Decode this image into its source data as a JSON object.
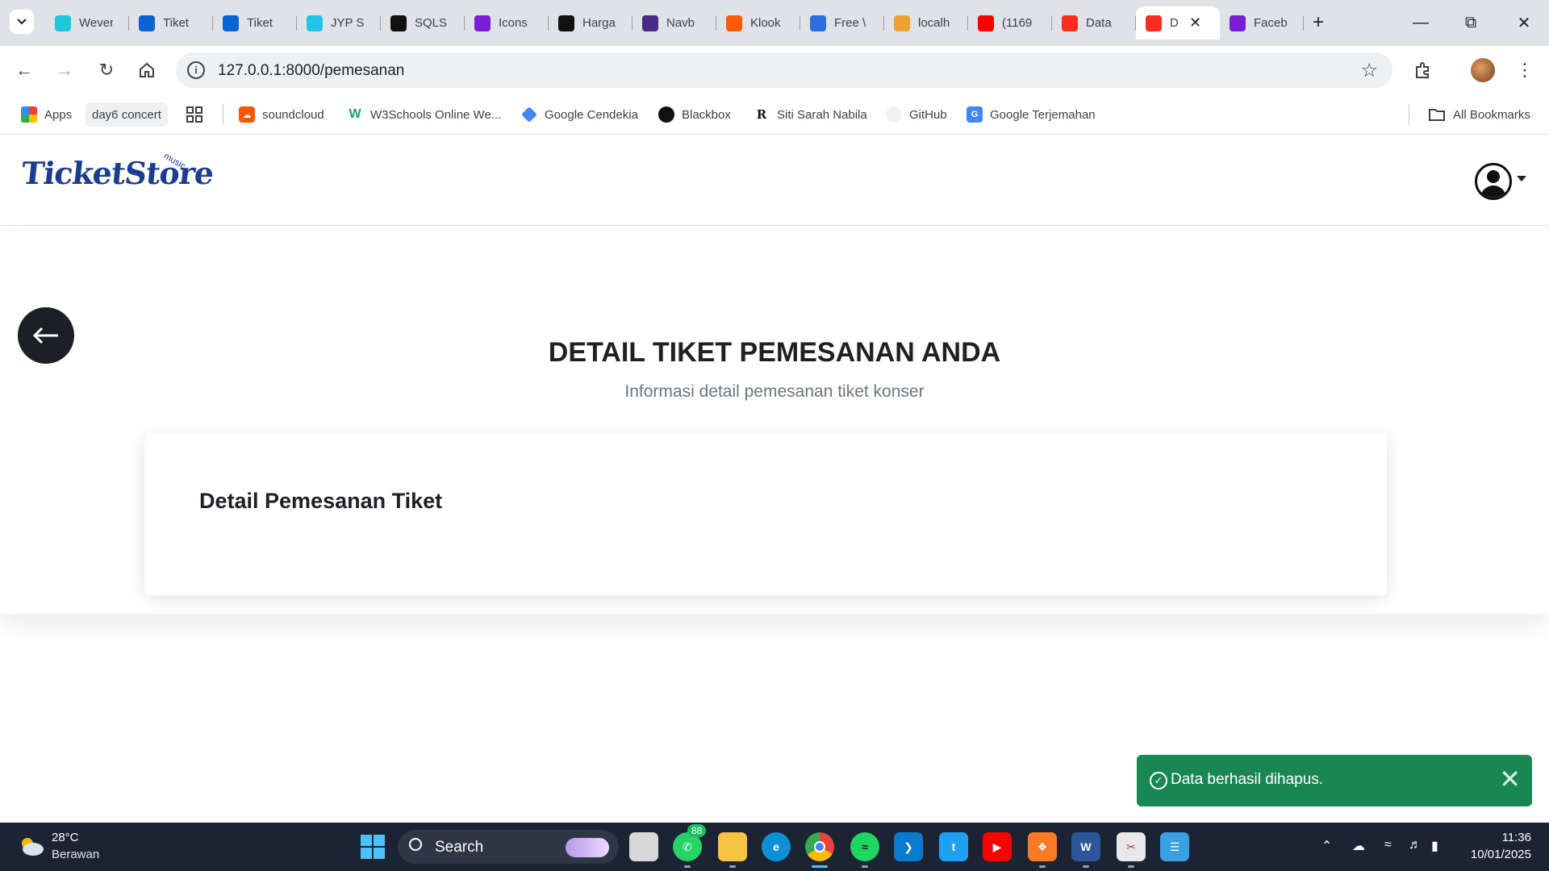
{
  "browser": {
    "tabs": [
      {
        "label": "Wever",
        "icon": "weverse-icon",
        "color": "#1ec8d8"
      },
      {
        "label": "Tiket",
        "icon": "tiket-icon",
        "color": "#0a64d6"
      },
      {
        "label": "Tiket",
        "icon": "tiket-icon",
        "color": "#0a64d6"
      },
      {
        "label": "JYP SI",
        "icon": "jyp-icon",
        "color": "#20c4e8"
      },
      {
        "label": "SQLS",
        "icon": "sqls-icon",
        "color": "#111111"
      },
      {
        "label": "Icons",
        "icon": "bootstrap-icon",
        "color": "#7a1fd6"
      },
      {
        "label": "Harga",
        "icon": "openai-icon",
        "color": "#111111"
      },
      {
        "label": "Navb",
        "icon": "bootstrap-icon",
        "color": "#4b2a86"
      },
      {
        "label": "Klook",
        "icon": "klook-icon",
        "color": "#ff5b00"
      },
      {
        "label": "Free \\",
        "icon": "form-icon",
        "color": "#2d6fe0"
      },
      {
        "label": "localh",
        "icon": "pma-icon",
        "color": "#f0a030"
      },
      {
        "label": "(1169",
        "icon": "youtube-icon",
        "color": "#ff0000"
      },
      {
        "label": "Data",
        "icon": "laravel-icon",
        "color": "#ff2d20"
      },
      {
        "label": "D",
        "icon": "laravel-icon",
        "color": "#ff2d20",
        "active": true
      },
      {
        "label": "Faceb",
        "icon": "bootstrap-icon",
        "color": "#7a1fd6"
      }
    ],
    "url": "127.0.0.1:8000/pemesanan",
    "bookmarks": [
      {
        "label": "Apps",
        "icon": "apps-grid-icon"
      },
      {
        "label": "day6 concert",
        "icon": ""
      },
      {
        "label": "",
        "icon": "grid-icon"
      },
      {
        "label": "soundcloud",
        "icon": "soundcloud-icon"
      },
      {
        "label": "W3Schools Online We...",
        "icon": "w3schools-icon"
      },
      {
        "label": "Google Cendekia",
        "icon": "scholar-icon"
      },
      {
        "label": "Blackbox",
        "icon": "blackbox-icon"
      },
      {
        "label": "Siti Sarah Nabila",
        "icon": "researchgate-icon"
      },
      {
        "label": "GitHub",
        "icon": "github-icon"
      },
      {
        "label": "Google Terjemahan",
        "icon": "translate-icon"
      }
    ],
    "all_bookmarks": "All Bookmarks"
  },
  "site": {
    "logo_text": "TicketStore",
    "logo_sub": "music",
    "page_title": "DETAIL TIKET PEMESANAN ANDA",
    "page_subtitle": "Informasi detail pemesanan tiket konser",
    "card_title": "Detail Pemesanan Tiket",
    "toast_message": "Data berhasil dihapus."
  },
  "taskbar": {
    "temperature": "28°C",
    "weather": "Berawan",
    "search": "Search",
    "whatsapp_badge": "88",
    "time": "11:36",
    "date": "10/01/2025"
  },
  "colors": {
    "toast": "#198754",
    "back_button": "#1c1f24",
    "logo": "#1a3d8f"
  }
}
